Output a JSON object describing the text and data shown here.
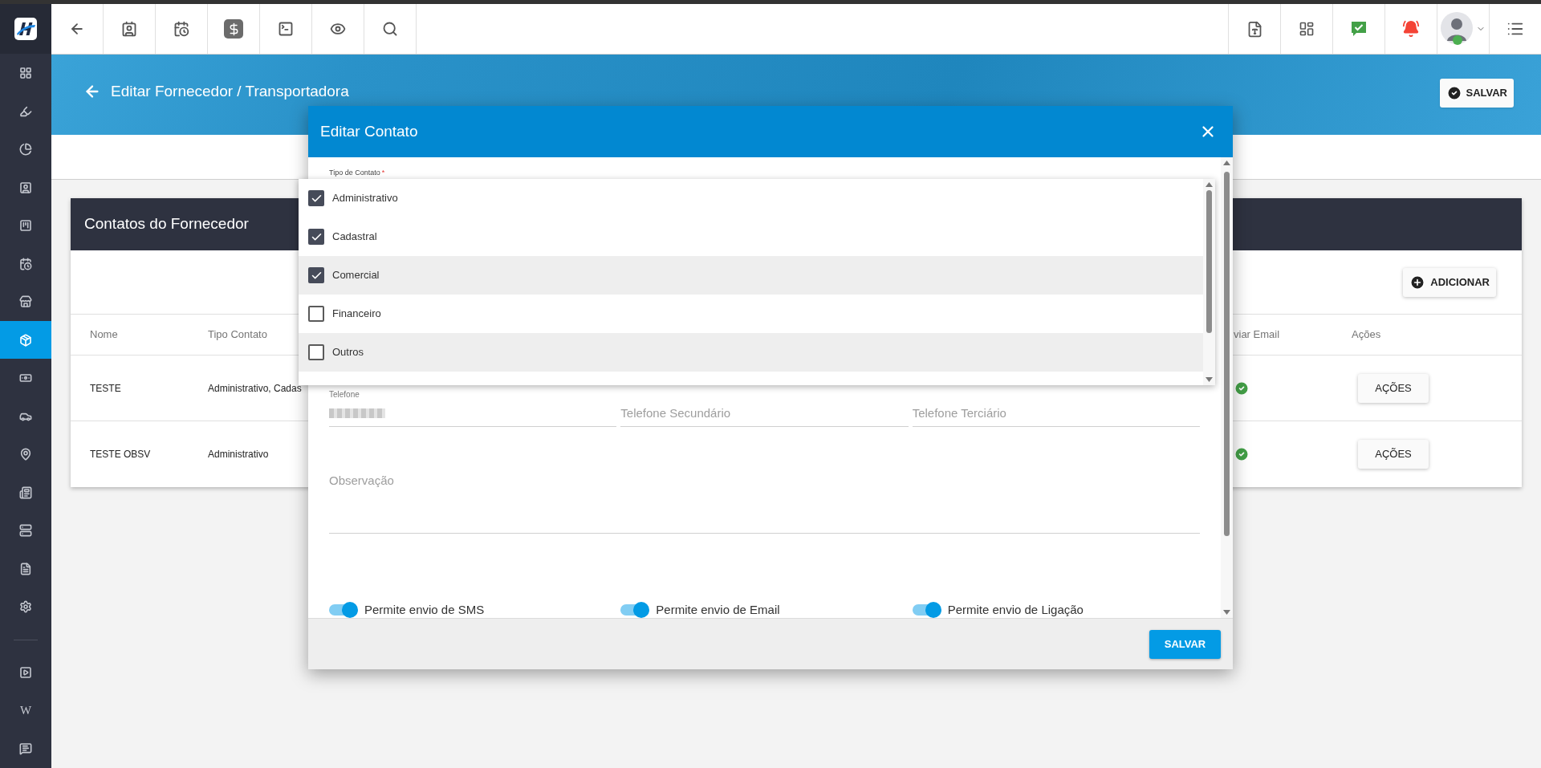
{
  "sidebar": {
    "items": [
      {
        "kind": "icon",
        "selected": false
      },
      {
        "kind": "icon",
        "selected": false
      },
      {
        "kind": "icon",
        "selected": false
      },
      {
        "kind": "icon",
        "selected": false
      },
      {
        "kind": "icon",
        "selected": false
      },
      {
        "kind": "icon",
        "selected": false
      },
      {
        "kind": "icon",
        "selected": false
      },
      {
        "kind": "icon",
        "selected": true
      },
      {
        "kind": "icon",
        "selected": false
      },
      {
        "kind": "icon",
        "selected": false
      },
      {
        "kind": "icon",
        "selected": false
      },
      {
        "kind": "icon",
        "selected": false
      },
      {
        "kind": "icon",
        "selected": false
      },
      {
        "kind": "icon",
        "selected": false
      },
      {
        "kind": "icon",
        "selected": false
      },
      {
        "kind": "divider"
      },
      {
        "kind": "icon",
        "selected": false
      },
      {
        "kind": "glyph",
        "glyph": "W",
        "selected": false
      },
      {
        "kind": "icon",
        "selected": false
      }
    ]
  },
  "page_header": {
    "title": "Editar Fornecedor / Transportadora",
    "save_button": "SALVAR"
  },
  "card": {
    "title": "Contatos do Fornecedor",
    "add_button": "ADICIONAR",
    "columns": [
      "Nome",
      "Tipo Contato",
      "viar Email",
      "Ações"
    ],
    "rows": [
      {
        "name": "TESTE",
        "type": "Administrativo, Cadas",
        "send_email": true,
        "action": "AÇÕES"
      },
      {
        "name": "TESTE OBSV",
        "type": "Administrativo",
        "send_email": true,
        "action": "AÇÕES"
      }
    ]
  },
  "modal": {
    "title": "Editar Contato",
    "type_label": "Tipo de Contato",
    "required_mark": "*",
    "options": [
      {
        "label": "Administrativo",
        "checked": true,
        "highlighted": false
      },
      {
        "label": "Cadastral",
        "checked": true,
        "highlighted": false
      },
      {
        "label": "Comercial",
        "checked": true,
        "highlighted": true
      },
      {
        "label": "Financeiro",
        "checked": false,
        "highlighted": false
      },
      {
        "label": "Outros",
        "checked": false,
        "highlighted": true
      }
    ],
    "phone_label": "Telefone",
    "phone_placeholders": [
      "Telefone Secundário",
      "Telefone Terciário"
    ],
    "notes_placeholder": "Observação",
    "toggles": [
      {
        "label": "Permite envio de SMS",
        "on": true
      },
      {
        "label": "Permite envio de Email",
        "on": true
      },
      {
        "label": "Permite envio de Ligação",
        "on": true
      }
    ],
    "save_button": "SALVAR"
  }
}
